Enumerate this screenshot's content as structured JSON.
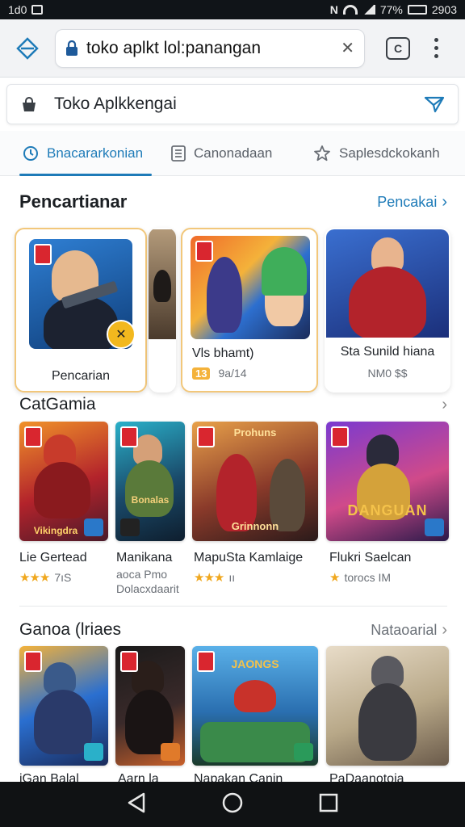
{
  "status_bar": {
    "left_text": "1d0",
    "battery_text": "77%",
    "time_text": "2903"
  },
  "browser": {
    "url_text": "toko aplkt lol:panangan"
  },
  "store": {
    "title": "Toko Aplkkengai"
  },
  "tabs": [
    {
      "label": "Bnacararkonian",
      "icon": "clock-icon",
      "active": true
    },
    {
      "label": "Canonadaan",
      "icon": "grid-icon",
      "active": false
    },
    {
      "label": "Saplesdckokanh",
      "icon": "star-icon",
      "active": false
    }
  ],
  "featured": {
    "title": "Pencartianar",
    "link": "Pencakai",
    "cards": [
      {
        "title": "Pencarian"
      },
      {
        "title": "Vls bhamt)",
        "rating": "13",
        "sub": "9a/14"
      },
      {
        "title": "Sta Sunild hiana",
        "sub": "NM0 $$"
      }
    ]
  },
  "category": {
    "title": "CatGamia",
    "tiles": [
      {
        "name": "Lie Gertead",
        "rating_text": "7ıS",
        "tile_text": "Vikingdra"
      },
      {
        "name": "Manikana",
        "extra": [
          "aoca Pmo",
          "Dolacxdaarit"
        ],
        "tile_text": "Bonalas"
      },
      {
        "name": "MapuSta Kamlaige",
        "rating_text": "ıı",
        "tile_text": "Grinnonn",
        "tile_text_top": "Prohuns"
      },
      {
        "name": "Flukri Saelcan",
        "rating_text": "torocs IM",
        "tile_text": "DANGUAN"
      }
    ]
  },
  "games": {
    "title": "Ganoa (lriaes",
    "link": "Nataoarial",
    "tiles": [
      {
        "name": "iGan Balal"
      },
      {
        "name": "Aarn la"
      },
      {
        "name": "Napakan Canin",
        "tile_text": "JAONGS"
      },
      {
        "name": "PaDaanotoia"
      }
    ]
  },
  "colors": {
    "accent": "#1e7bb8",
    "star": "#f0a820",
    "highlight_border": "#f2c77a"
  }
}
